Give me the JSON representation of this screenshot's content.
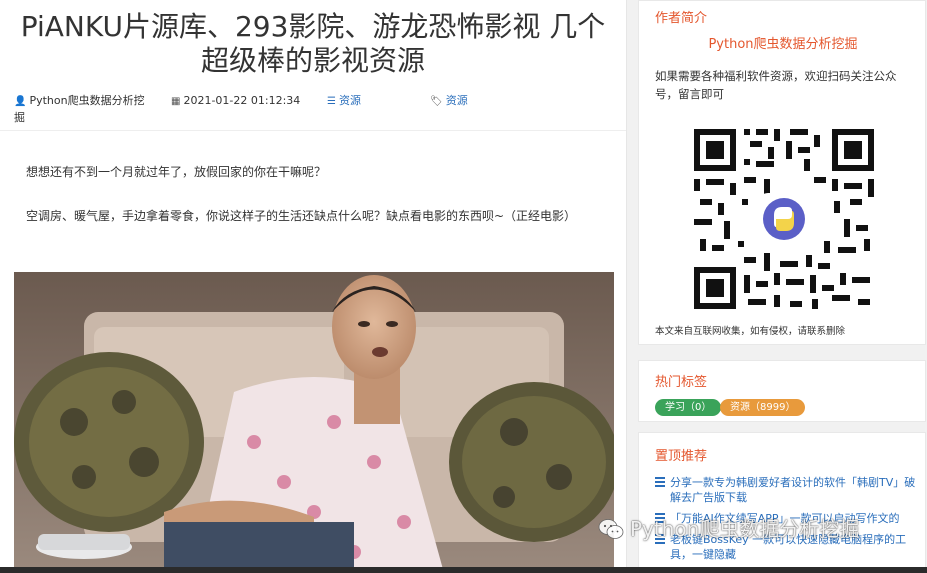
{
  "article": {
    "title_line1": "PiANKU片源库、293影院、游龙恐怖影视 几个",
    "title_line2": "超级棒的影视资源",
    "meta": {
      "author": "Python爬虫数据分析挖掘",
      "datetime": "2021-01-22 01:12:34",
      "category": "资源",
      "tag": "资源"
    },
    "paragraphs": [
      "想想还有不到一个月就过年了，放假回家的你在干嘛呢？",
      "空调房、暖气屋，手边拿着零食，你说这样子的生活还缺点什么呢？缺点看电影的东西呗~（正经电影）"
    ]
  },
  "sidebar": {
    "author_card": {
      "heading": "作者简介",
      "name": "Python爬虫数据分析挖掘",
      "description": "如果需要各种福利软件资源，欢迎扫码关注公众号，留言即可",
      "note": "本文来自互联网收集，如有侵权，请联系删除"
    },
    "tags_card": {
      "heading": "热门标签",
      "tags": [
        {
          "label": "学习（0）",
          "color": "#3aa35a"
        },
        {
          "label": "资源（8999）",
          "color": "#e89a3c"
        }
      ]
    },
    "top_card": {
      "heading": "置顶推荐",
      "items": [
        "分享一款专为韩剧爱好者设计的软件「韩剧TV」破解去广告版下载",
        "「万能AI作文续写APP」一款可以启动写作文的",
        "老板键BossKey 一款可以快速隐藏电脑程序的工具，一键隐藏"
      ]
    }
  },
  "watermark": "Python爬虫数据分析挖掘",
  "colors": {
    "accent": "#e4572e",
    "link": "#2a6ebb"
  }
}
